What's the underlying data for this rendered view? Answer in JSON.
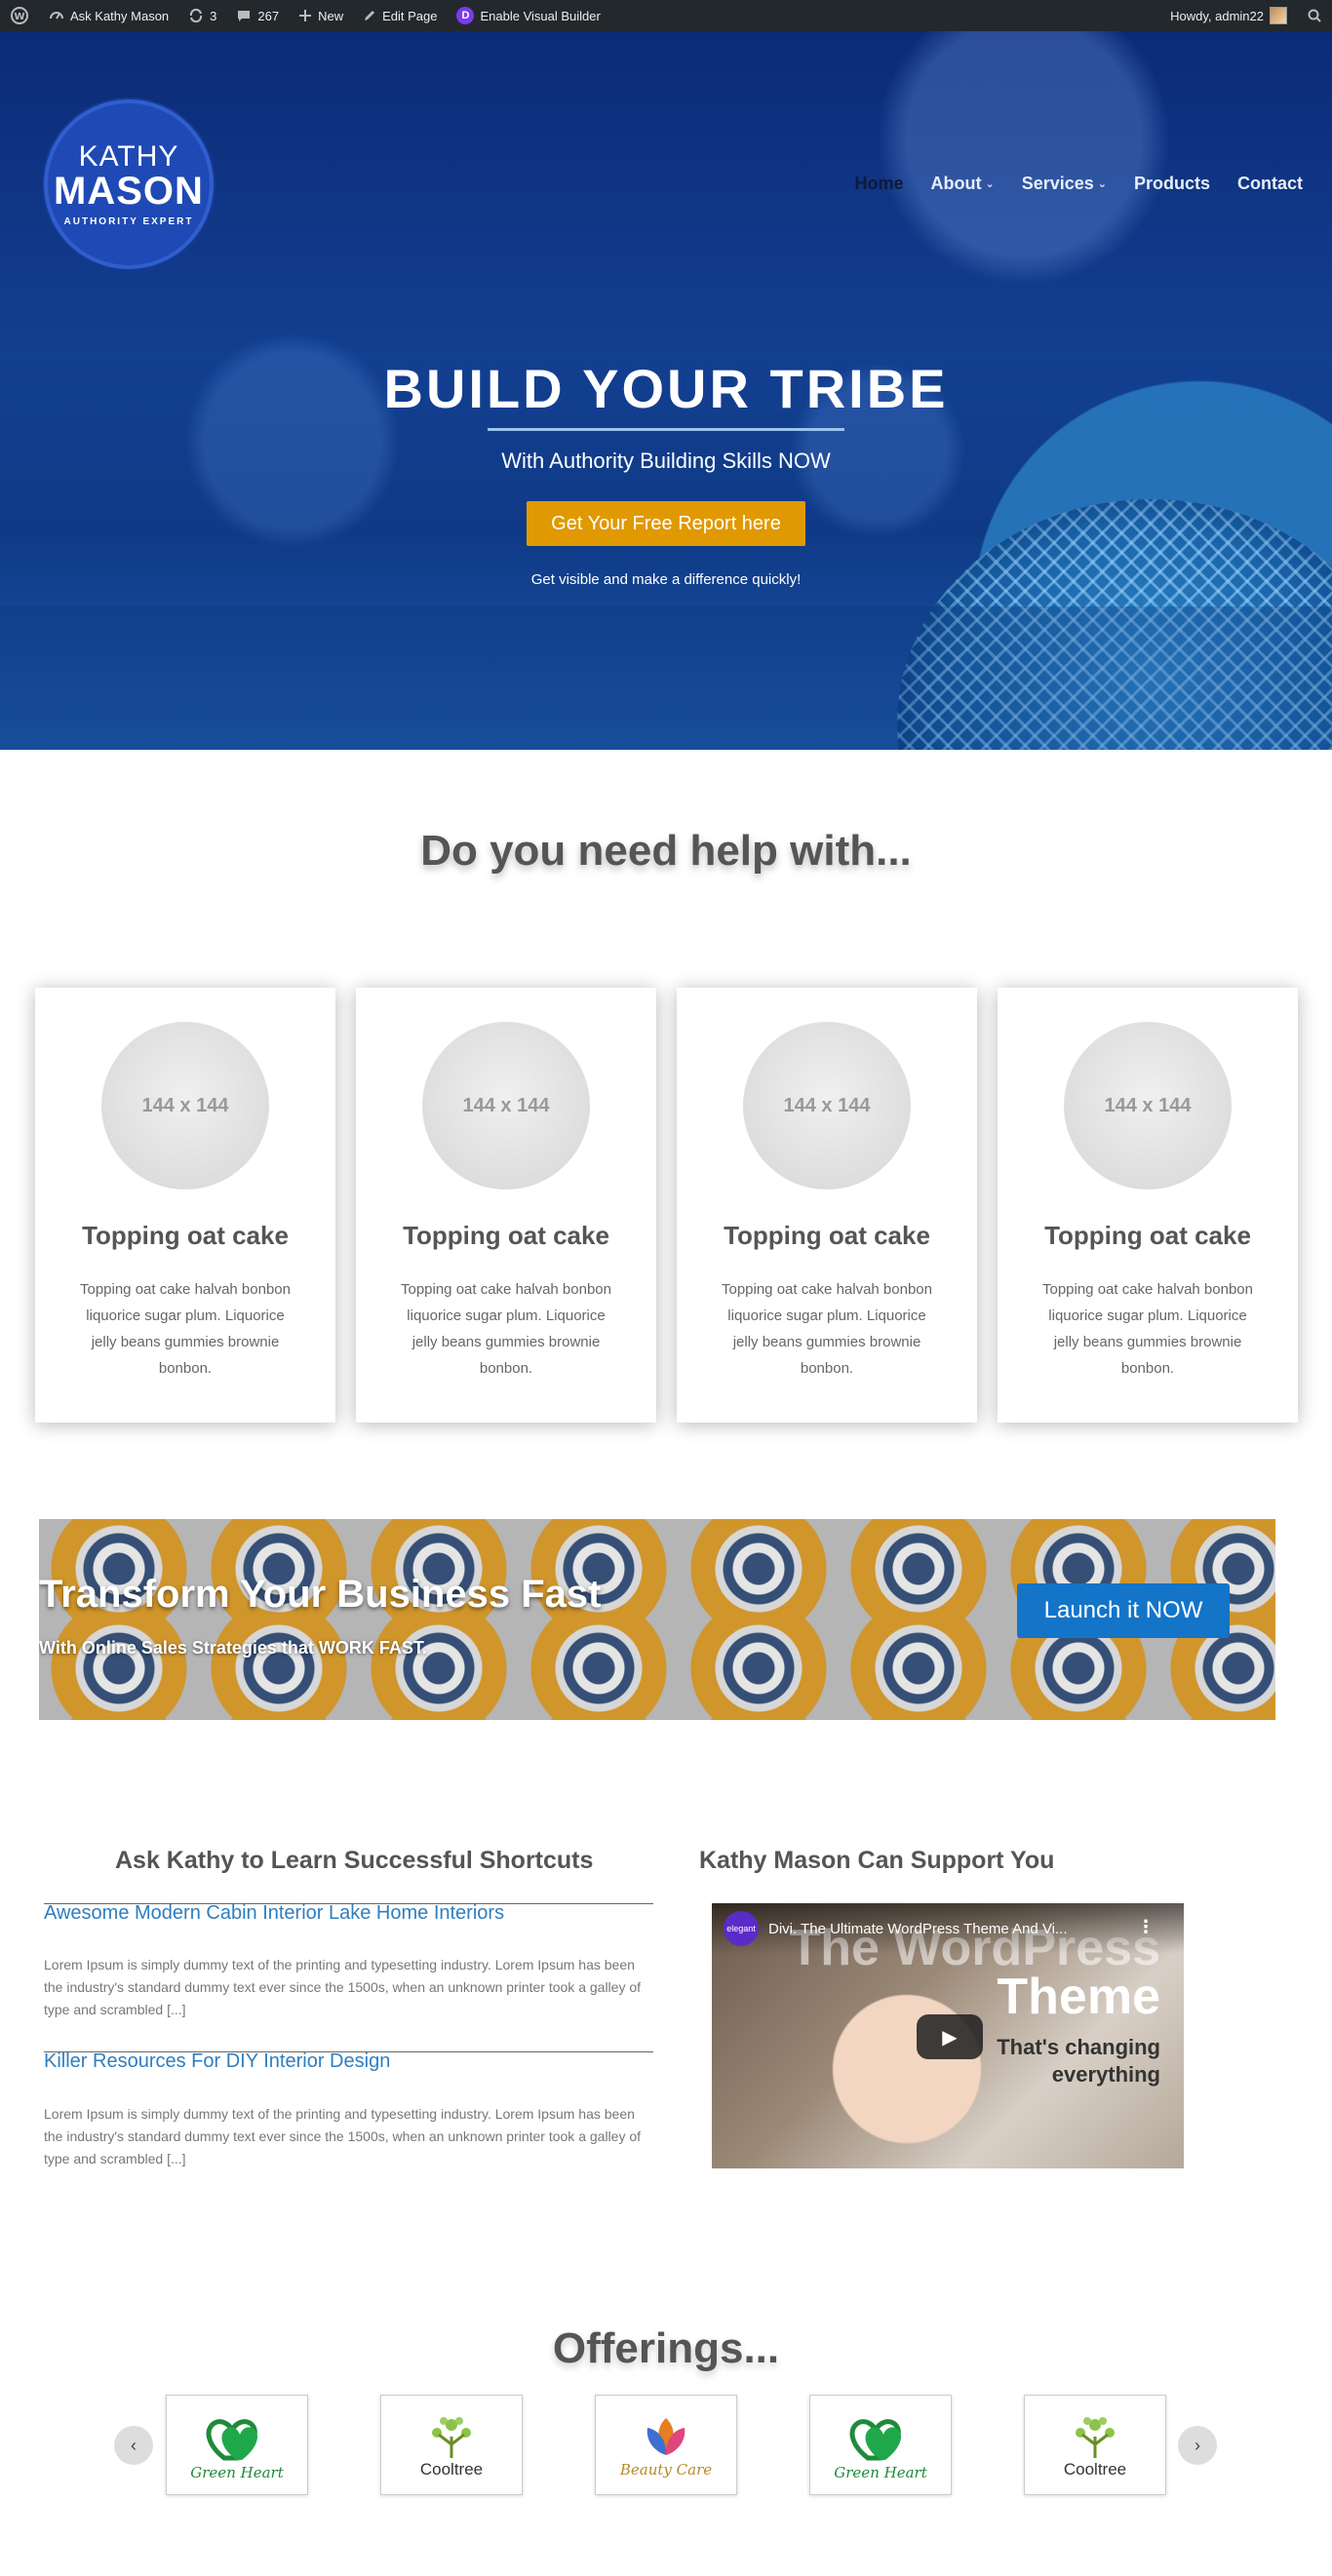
{
  "adminbar": {
    "site_name": "Ask Kathy Mason",
    "updates_count": "3",
    "comments_count": "267",
    "new_label": "New",
    "edit_label": "Edit Page",
    "visual_builder_label": "Enable Visual Builder",
    "howdy": "Howdy, admin22"
  },
  "header": {
    "logo": {
      "line1": "KATHY",
      "line2": "MASON",
      "tagline": "AUTHORITY EXPERT"
    },
    "nav": [
      {
        "label": "Home",
        "active": true,
        "dropdown": false
      },
      {
        "label": "About",
        "active": false,
        "dropdown": true
      },
      {
        "label": "Services",
        "active": false,
        "dropdown": true
      },
      {
        "label": "Products",
        "active": false,
        "dropdown": false
      },
      {
        "label": "Contact",
        "active": false,
        "dropdown": false
      }
    ]
  },
  "hero": {
    "title": "BUILD YOUR TRIBE",
    "subtitle": "With Authority Building Skills NOW",
    "button": "Get Your Free Report here",
    "small_text": "Get visible and make a difference quickly!"
  },
  "help": {
    "title": "Do you need help with...",
    "cards": [
      {
        "image_label": "144 x 144",
        "title": "Topping oat cake",
        "text": "Topping oat cake halvah bonbon liquorice sugar plum. Liquorice jelly beans gummies brownie bonbon."
      },
      {
        "image_label": "144 x 144",
        "title": "Topping oat cake",
        "text": "Topping oat cake halvah bonbon liquorice sugar plum. Liquorice jelly beans gummies brownie bonbon."
      },
      {
        "image_label": "144 x 144",
        "title": "Topping oat cake",
        "text": "Topping oat cake halvah bonbon liquorice sugar plum. Liquorice jelly beans gummies brownie bonbon."
      },
      {
        "image_label": "144 x 144",
        "title": "Topping oat cake",
        "text": "Topping oat cake halvah bonbon liquorice sugar plum. Liquorice jelly beans gummies brownie bonbon."
      }
    ]
  },
  "cta": {
    "title": "Transform Your Business Fast",
    "subtitle": "With Online Sales Strategies that WORK FAST.",
    "button": "Launch it NOW"
  },
  "blog": {
    "title": "Ask Kathy to Learn Successful Shortcuts",
    "posts": [
      {
        "title": "Awesome Modern Cabin Interior Lake Home Interiors",
        "excerpt": "Lorem Ipsum is simply dummy text of the printing and typesetting industry. Lorem Ipsum has been the industry's standard dummy text ever since the 1500s, when an unknown printer took a galley of type and scrambled [...]"
      },
      {
        "title": "Killer Resources For DIY Interior Design",
        "excerpt": "Lorem Ipsum is simply dummy text of the printing and typesetting industry. Lorem Ipsum has been the industry's standard dummy text ever since the 1500s, when an unknown printer took a galley of type and scrambled [...]"
      }
    ]
  },
  "video": {
    "section_title": "Kathy Mason Can Support You",
    "channel_badge": "elegant",
    "title": "Divi. The Ultimate WordPress Theme And Vi...",
    "overlay_line1": "The WordPress",
    "overlay_line2": "Theme",
    "overlay_line3": "That's changing everything"
  },
  "offerings": {
    "title": "Offerings...",
    "logos": [
      {
        "name": "Green Heart",
        "icon": "green-heart-logo"
      },
      {
        "name": "Cooltree",
        "icon": "cooltree-logo"
      },
      {
        "name": "Beauty Care",
        "icon": "beauty-care-logo"
      },
      {
        "name": "Green Heart",
        "icon": "green-heart-logo"
      },
      {
        "name": "Cooltree",
        "icon": "cooltree-logo"
      }
    ]
  },
  "colors": {
    "hero_blue": "#133f91",
    "hero_button": "#e09900",
    "cta_button": "#1474c8",
    "link_blue": "#2e7ec1",
    "adminbar": "#23282d"
  }
}
